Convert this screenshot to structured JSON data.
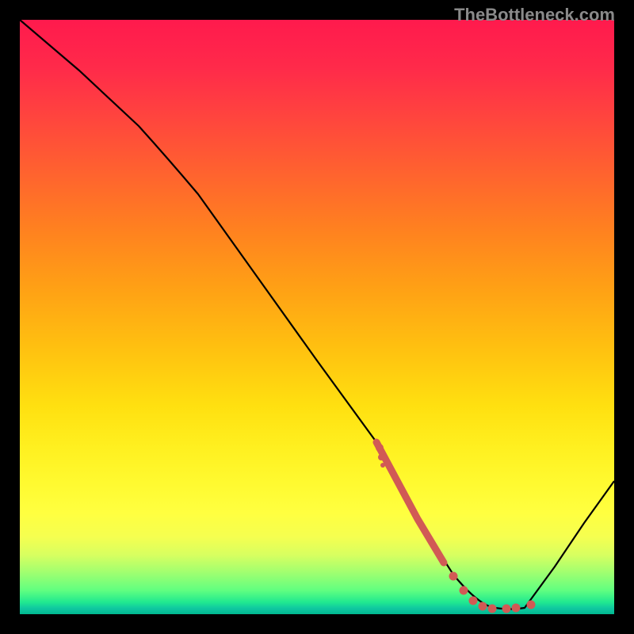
{
  "watermark": "TheBottleneck.com",
  "chart_data": {
    "type": "line",
    "title": "",
    "xlabel": "",
    "ylabel": "",
    "xlim": [
      0,
      100
    ],
    "ylim": [
      0,
      100
    ],
    "series": [
      {
        "name": "bottleneck-curve",
        "x": [
          0,
          10,
          20,
          30,
          40,
          50,
          60,
          67,
          73,
          80,
          85,
          90,
          95,
          100
        ],
        "values": [
          100,
          91,
          82,
          71,
          57,
          43,
          29,
          16,
          6,
          1,
          1,
          8,
          15,
          22
        ]
      }
    ],
    "markers": {
      "name": "highlight-segment",
      "color": "#d9534f",
      "x_range": [
        60,
        84
      ],
      "style": "dotted-thick"
    },
    "background": "vertical-gradient-red-to-green"
  }
}
